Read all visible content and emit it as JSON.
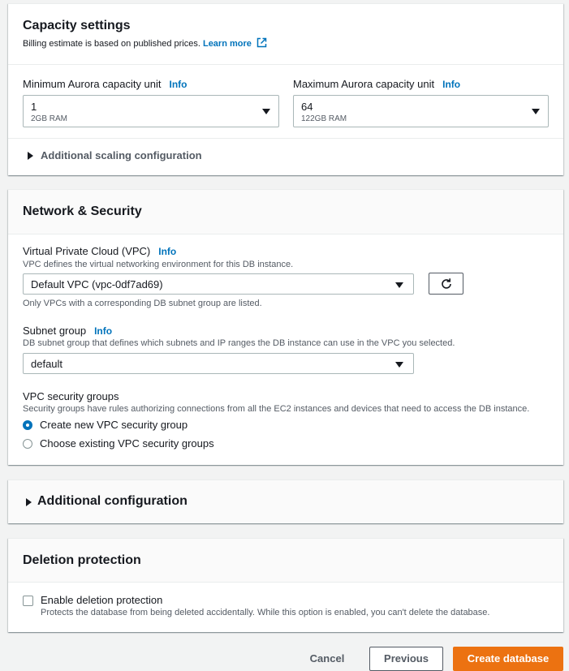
{
  "capacity": {
    "title": "Capacity settings",
    "billing_note": "Billing estimate is based on published prices.",
    "learn_more": "Learn more",
    "min_label": "Minimum Aurora capacity unit",
    "min_info": "Info",
    "min_value": "1",
    "min_sub": "2GB RAM",
    "max_label": "Maximum Aurora capacity unit",
    "max_info": "Info",
    "max_value": "64",
    "max_sub": "122GB RAM",
    "scaling_toggle": "Additional scaling configuration"
  },
  "network": {
    "title": "Network & Security",
    "vpc_label": "Virtual Private Cloud (VPC)",
    "vpc_info": "Info",
    "vpc_desc": "VPC defines the virtual networking environment for this DB instance.",
    "vpc_value": "Default VPC (vpc-0df7ad69)",
    "vpc_hint": "Only VPCs with a corresponding DB subnet group are listed.",
    "subnet_label": "Subnet group",
    "subnet_info": "Info",
    "subnet_desc": "DB subnet group that defines which subnets and IP ranges the DB instance can use in the VPC you selected.",
    "subnet_value": "default",
    "sg_label": "VPC security groups",
    "sg_desc": "Security groups have rules authorizing connections from all the EC2 instances and devices that need to access the DB instance.",
    "sg_options": [
      "Create new VPC security group",
      "Choose existing VPC security groups"
    ],
    "sg_selected": 0
  },
  "additional": {
    "title": "Additional configuration"
  },
  "deletion": {
    "title": "Deletion protection",
    "checkbox_label": "Enable deletion protection",
    "checkbox_desc": "Protects the database from being deleted accidentally. While this option is enabled, you can't delete the database.",
    "checked": false
  },
  "footer": {
    "cancel": "Cancel",
    "previous": "Previous",
    "create": "Create database"
  },
  "colors": {
    "accent": "#0073bb",
    "primary_button": "#ec7211"
  },
  "icons": {
    "external_link": "external-link-icon",
    "refresh": "refresh-icon",
    "caret": "chevron-down-icon",
    "expand": "caret-right-icon"
  }
}
